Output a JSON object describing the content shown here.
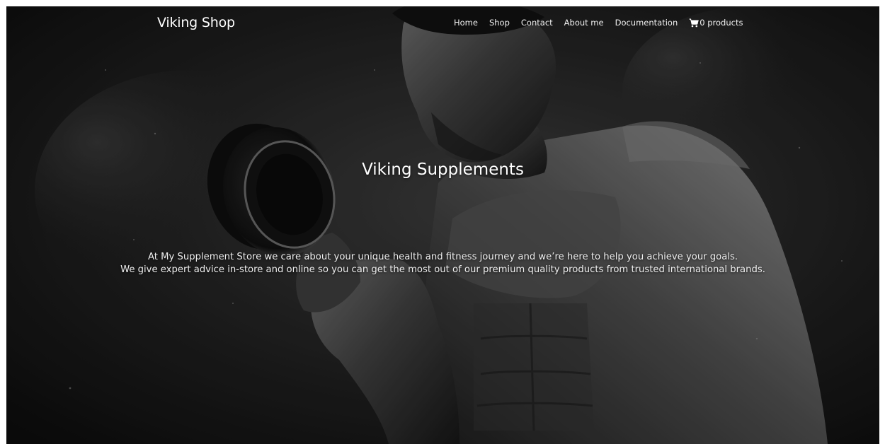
{
  "navbar": {
    "brand": "Viking Shop",
    "links": [
      {
        "label": "Home"
      },
      {
        "label": "Shop"
      },
      {
        "label": "Contact"
      },
      {
        "label": "About me"
      },
      {
        "label": "Documentation"
      }
    ],
    "cart": {
      "icon": "shopping-cart-icon",
      "label": "0 products"
    }
  },
  "hero": {
    "title": "Viking Supplements",
    "paragraph_line_1": "At My Supplement Store we care about your unique health and fitness journey and we’re here to help you achieve your goals.",
    "paragraph_line_2": "We give expert advice in-store and online so you can get the most out of our premium quality products from trusted international brands.",
    "background_image": "bodybuilder-with-dumbbell-photo"
  },
  "colors": {
    "background": "#141414",
    "text": "#ffffff"
  }
}
